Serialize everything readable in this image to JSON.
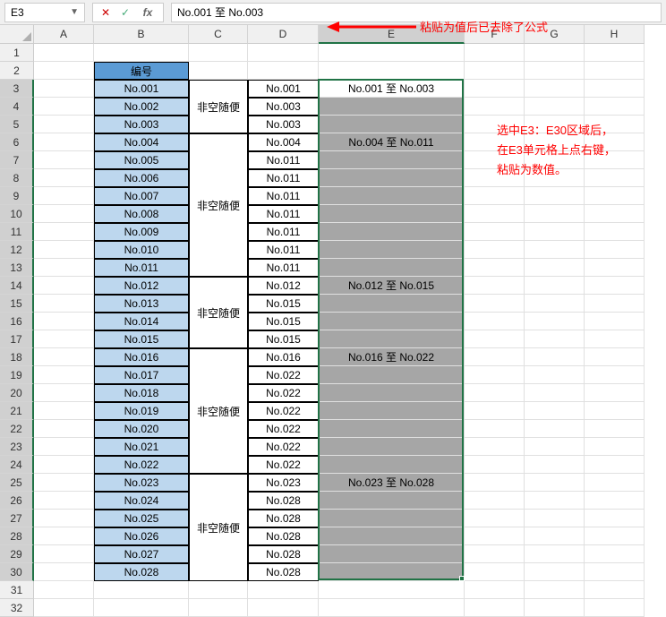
{
  "formulaBar": {
    "nameBox": "E3",
    "formula": "No.001  至  No.003"
  },
  "annotations": {
    "arrowText": "粘贴为值后已去除了公式",
    "noteLine1": "选中E3：E30区域后，",
    "noteLine2": "在E3单元格上点右键，",
    "noteLine3": "粘贴为数值。"
  },
  "columns": [
    "A",
    "B",
    "C",
    "D",
    "E",
    "F",
    "G",
    "H"
  ],
  "rows": [
    1,
    2,
    3,
    4,
    5,
    6,
    7,
    8,
    9,
    10,
    11,
    12,
    13,
    14,
    15,
    16,
    17,
    18,
    19,
    20,
    21,
    22,
    23,
    24,
    25,
    26,
    27,
    28,
    29,
    30,
    31,
    32
  ],
  "headerB": "编号",
  "colB": [
    "No.001",
    "No.002",
    "No.003",
    "No.004",
    "No.005",
    "No.006",
    "No.007",
    "No.008",
    "No.009",
    "No.010",
    "No.011",
    "No.012",
    "No.013",
    "No.014",
    "No.015",
    "No.016",
    "No.017",
    "No.018",
    "No.019",
    "No.020",
    "No.021",
    "No.022",
    "No.023",
    "No.024",
    "No.025",
    "No.026",
    "No.027",
    "No.028"
  ],
  "colCGroups": [
    {
      "start": 3,
      "end": 5,
      "text": "非空随便"
    },
    {
      "start": 6,
      "end": 13,
      "text": "非空随便"
    },
    {
      "start": 14,
      "end": 17,
      "text": "非空随便"
    },
    {
      "start": 18,
      "end": 24,
      "text": "非空随便"
    },
    {
      "start": 25,
      "end": 30,
      "text": "非空随便"
    }
  ],
  "colD": [
    "No.001",
    "No.003",
    "No.003",
    "No.004",
    "No.011",
    "No.011",
    "No.011",
    "No.011",
    "No.011",
    "No.011",
    "No.011",
    "No.012",
    "No.015",
    "No.015",
    "No.015",
    "No.016",
    "No.022",
    "No.022",
    "No.022",
    "No.022",
    "No.022",
    "No.022",
    "No.023",
    "No.028",
    "No.028",
    "No.028",
    "No.028",
    "No.028"
  ],
  "colE": {
    "r3": "No.001  至  No.003",
    "r6": "No.004  至  No.011",
    "r14": "No.012  至  No.015",
    "r18": "No.016  至  No.022",
    "r25": "No.023  至  No.028"
  }
}
